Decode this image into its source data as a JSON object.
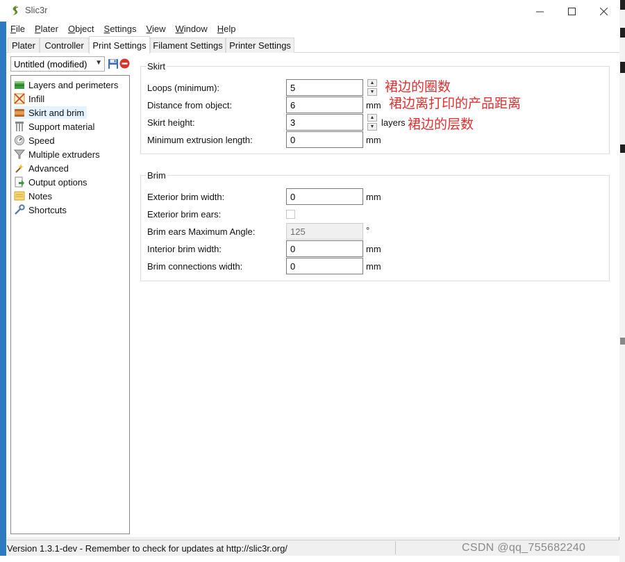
{
  "window": {
    "title": "Slic3r"
  },
  "menu": [
    {
      "label": "File",
      "mnemonic": "F",
      "rest": "ile"
    },
    {
      "label": "Plater",
      "mnemonic": "P",
      "rest": "later"
    },
    {
      "label": "Object",
      "mnemonic": "O",
      "rest": "bject"
    },
    {
      "label": "Settings",
      "mnemonic": "S",
      "rest": "ettings"
    },
    {
      "label": "View",
      "mnemonic": "V",
      "rest": "iew"
    },
    {
      "label": "Window",
      "mnemonic": "W",
      "rest": "indow"
    },
    {
      "label": "Help",
      "mnemonic": "H",
      "rest": "elp"
    }
  ],
  "tabs": [
    "Plater",
    "Controller",
    "Print Settings",
    "Filament Settings",
    "Printer Settings"
  ],
  "active_tab": "Print Settings",
  "preset": {
    "value": "Untitled (modified)"
  },
  "sidebar": {
    "items": [
      {
        "label": "Layers and perimeters",
        "icon": "layers-icon"
      },
      {
        "label": "Infill",
        "icon": "infill-icon"
      },
      {
        "label": "Skirt and brim",
        "icon": "skirt-brim-icon"
      },
      {
        "label": "Support material",
        "icon": "support-icon"
      },
      {
        "label": "Speed",
        "icon": "speed-icon"
      },
      {
        "label": "Multiple extruders",
        "icon": "extruders-icon"
      },
      {
        "label": "Advanced",
        "icon": "advanced-icon"
      },
      {
        "label": "Output options",
        "icon": "output-icon"
      },
      {
        "label": "Notes",
        "icon": "notes-icon"
      },
      {
        "label": "Shortcuts",
        "icon": "shortcuts-icon"
      }
    ],
    "selected": "Skirt and brim"
  },
  "skirt": {
    "title": "Skirt",
    "loops_label": "Loops (minimum):",
    "loops_value": "5",
    "distance_label": "Distance from object:",
    "distance_value": "6",
    "distance_unit": "mm",
    "height_label": "Skirt height:",
    "height_value": "3",
    "height_unit": "layers",
    "min_extrusion_label": "Minimum extrusion length:",
    "min_extrusion_value": "0",
    "min_extrusion_unit": "mm"
  },
  "brim": {
    "title": "Brim",
    "ext_width_label": "Exterior brim width:",
    "ext_width_value": "0",
    "ext_width_unit": "mm",
    "ears_label": "Exterior brim ears:",
    "ears_angle_label": "Brim ears Maximum Angle:",
    "ears_angle_value": "125",
    "ears_angle_unit": "°",
    "int_width_label": "Interior brim width:",
    "int_width_value": "0",
    "int_width_unit": "mm",
    "connections_label": "Brim connections width:",
    "connections_value": "0",
    "connections_unit": "mm"
  },
  "annotations": {
    "loops": "裙边的圈数",
    "distance": "裙边离打印的产品距离",
    "height": "裙边的层数"
  },
  "status": {
    "text": "Version 1.3.1-dev - Remember to check for updates at http://slic3r.org/"
  },
  "watermark": "CSDN @qq_755682240",
  "colors": {
    "accent": "#2d7ac3",
    "annotation": "#e03030",
    "selection": "#e5f3ff"
  }
}
